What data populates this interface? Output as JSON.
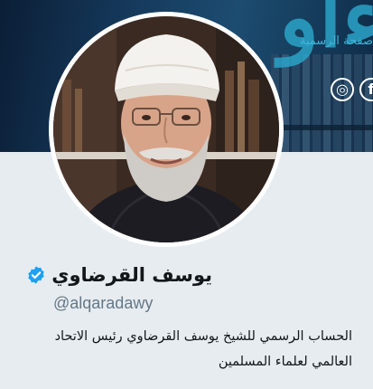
{
  "banner": {
    "calligraphy": "ءاو",
    "caption": "صفحة الرسمية",
    "icons": [
      {
        "name": "instagram-icon",
        "glyph": "◎"
      },
      {
        "name": "facebook-icon",
        "glyph": "f"
      }
    ]
  },
  "profile": {
    "name": "يوسف القرضاوي",
    "verified": true,
    "handle": "@alqaradawy",
    "bio": "الحساب الرسمي للشيخ يوسف القرضاوي رئيس الاتحاد العالمي لعلماء المسلمين"
  },
  "colors": {
    "verified_badge": "#1da1f2",
    "page_background": "#e6ecf0",
    "handle_text": "#657786",
    "banner_accent": "#2aa3c7"
  }
}
